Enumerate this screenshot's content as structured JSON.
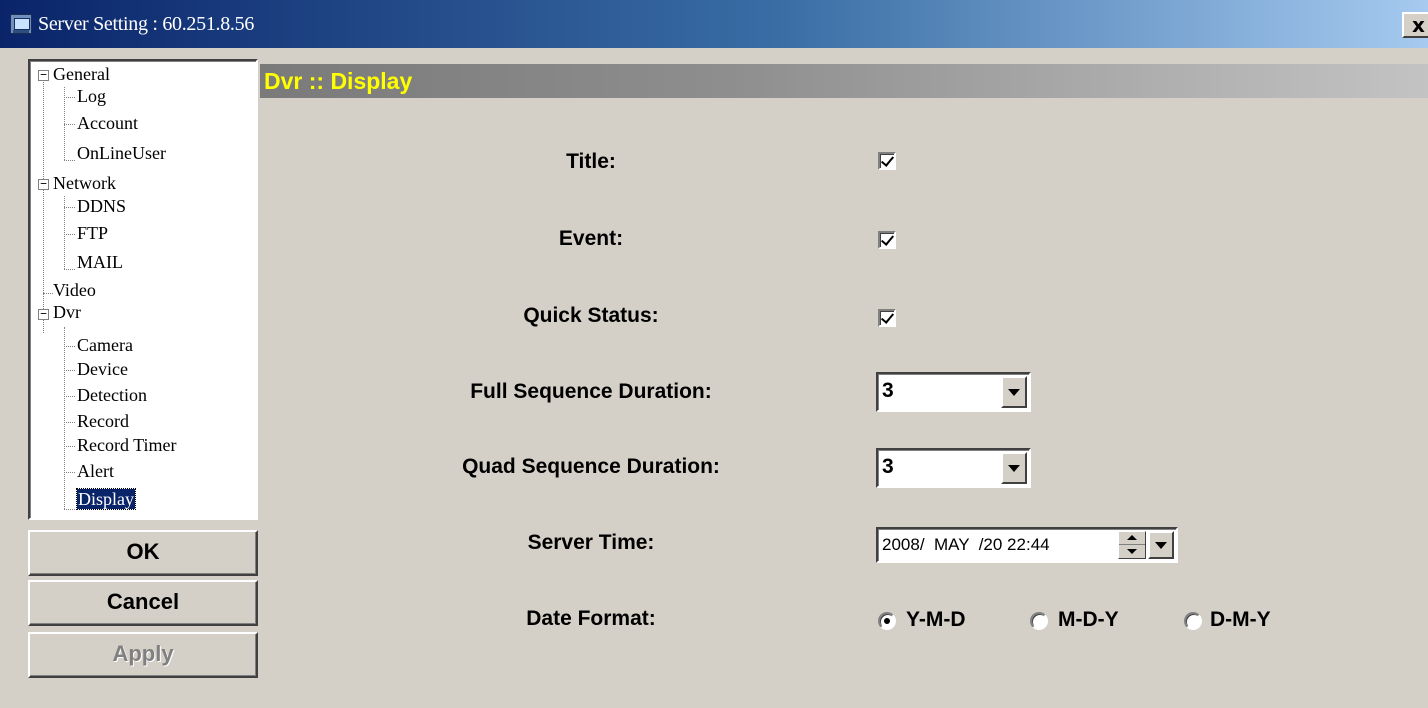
{
  "window": {
    "title": "Server Setting : 60.251.8.56",
    "close_label": "x"
  },
  "tree": {
    "groups": [
      {
        "label": "General",
        "expander": "−",
        "children": [
          "Log",
          "Account",
          "OnLineUser"
        ]
      },
      {
        "label": "Network",
        "expander": "−",
        "children": [
          "DDNS",
          "FTP",
          "MAIL"
        ]
      },
      {
        "label": "Video"
      },
      {
        "label": "Dvr",
        "expander": "−",
        "children": [
          "Camera",
          "Device",
          "Detection",
          "Record",
          "Record Timer",
          "Alert",
          "Display"
        ]
      }
    ],
    "selected": "Display"
  },
  "buttons": {
    "ok": "OK",
    "cancel": "Cancel",
    "apply": "Apply"
  },
  "panel": {
    "header": "Dvr :: Display",
    "fields": {
      "title": {
        "label": "Title:",
        "checked": true
      },
      "event": {
        "label": "Event:",
        "checked": true
      },
      "quick_status": {
        "label": "Quick Status:",
        "checked": true
      },
      "full_sequence": {
        "label": "Full Sequence Duration:",
        "value": "3"
      },
      "quad_sequence": {
        "label": "Quad Sequence Duration:",
        "value": "3"
      },
      "server_time": {
        "label": "Server Time:",
        "value": "2008/  MAY  /20 22:44"
      },
      "date_format": {
        "label": "Date Format:",
        "options": [
          "Y-M-D",
          "M-D-Y",
          "D-M-Y"
        ],
        "selected": "Y-M-D"
      }
    }
  },
  "colors": {
    "header_text": "#ffff00",
    "titlebar_start": "#0a246a",
    "selection": "#0a246a"
  }
}
